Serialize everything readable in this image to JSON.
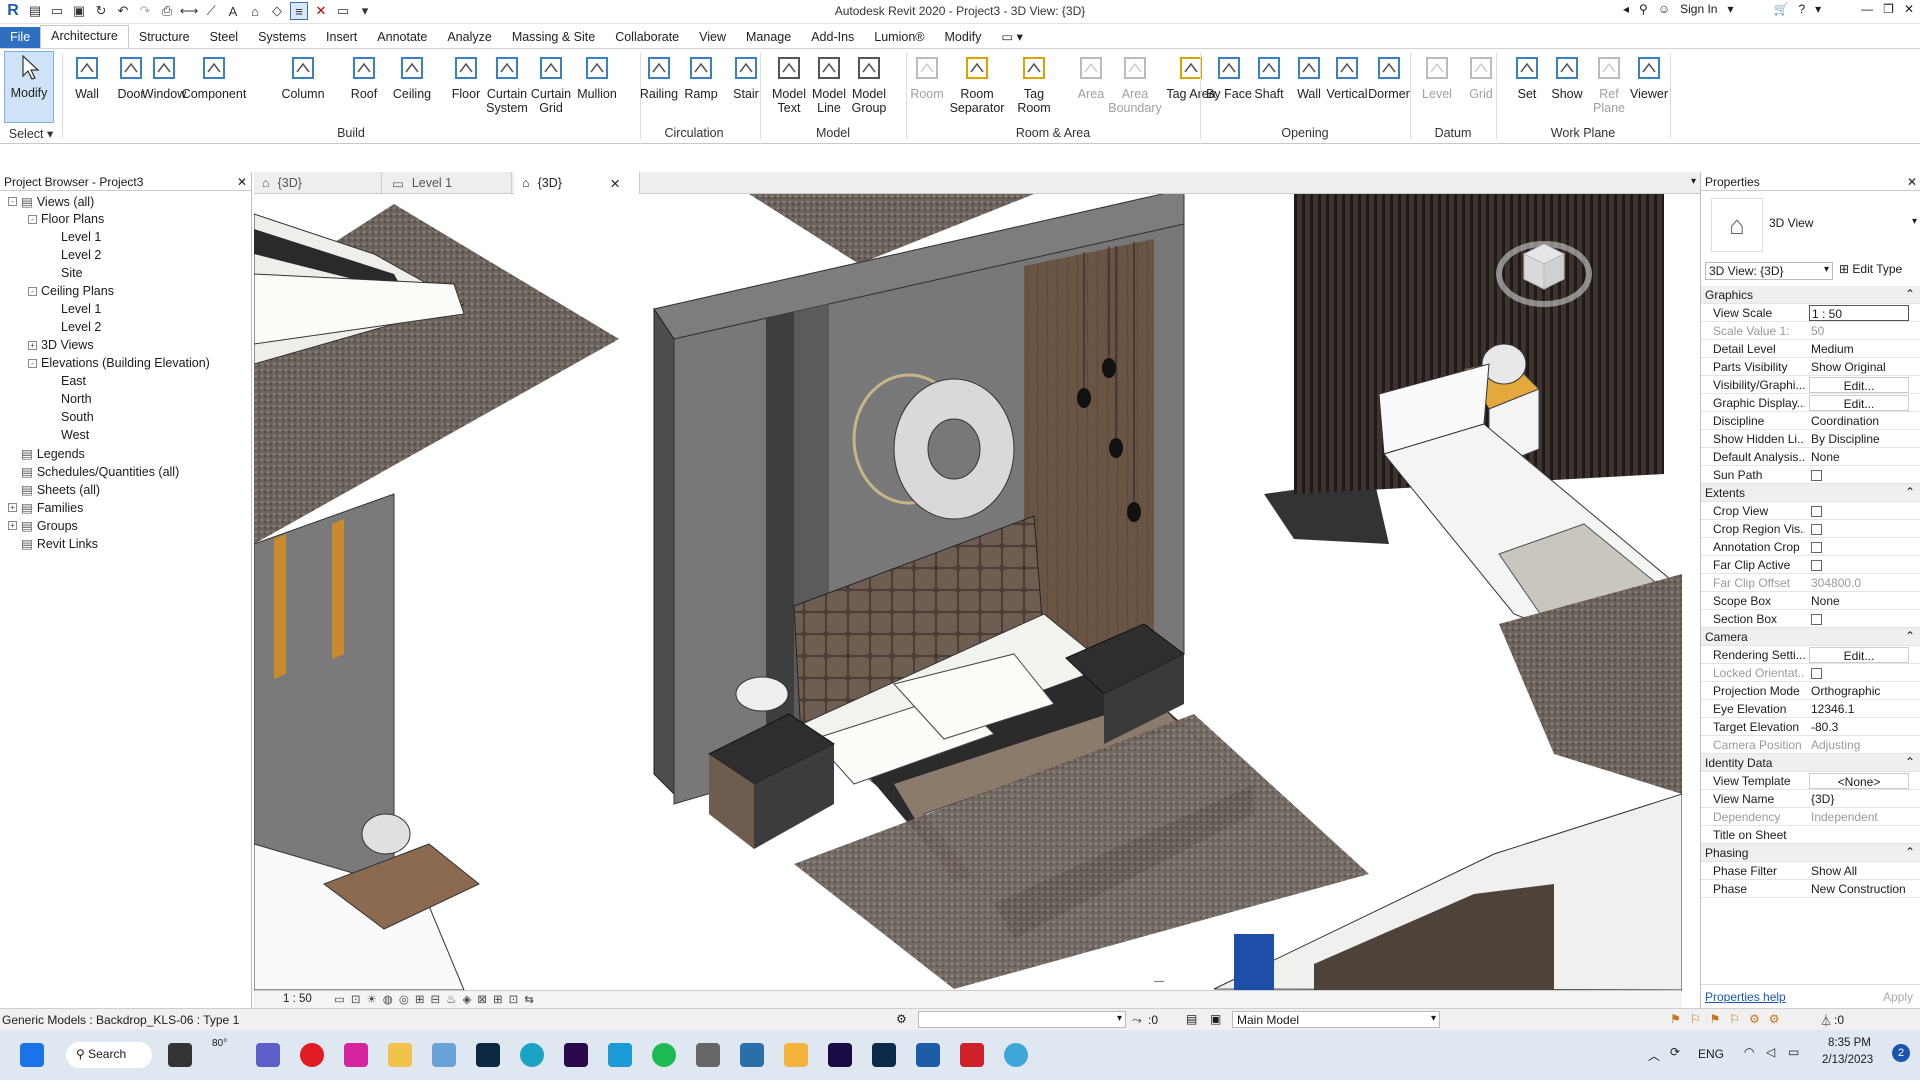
{
  "app_title": "Autodesk Revit 2020 - Project3 - 3D View: {3D}",
  "signin": "Sign In",
  "menu_tabs": [
    "File",
    "Architecture",
    "Structure",
    "Steel",
    "Systems",
    "Insert",
    "Annotate",
    "Analyze",
    "Massing & Site",
    "Collaborate",
    "View",
    "Manage",
    "Add-Ins",
    "Lumion®",
    "Modify"
  ],
  "ribbon": {
    "select_label": "Select",
    "modify": "Modify",
    "build": [
      "Wall",
      "Door",
      "Window",
      "Component",
      "Column",
      "Roof",
      "Ceiling",
      "Floor",
      "Curtain System",
      "Curtain Grid",
      "Mullion"
    ],
    "build_group": "Build",
    "circulation": [
      "Railing",
      "Ramp",
      "Stair"
    ],
    "circulation_group": "Circulation",
    "model": [
      "Model Text",
      "Model Line",
      "Model Group"
    ],
    "model_group": "Model",
    "room": [
      "Room",
      "Room Separator",
      "Tag Room",
      "Area",
      "Area Boundary",
      "Tag Area"
    ],
    "room_group": "Room & Area",
    "opening": [
      "By Face",
      "Shaft",
      "Wall",
      "Vertical",
      "Dormer"
    ],
    "opening_group": "Opening",
    "datum": [
      "Level",
      "Grid"
    ],
    "datum_group": "Datum",
    "workplane": [
      "Set",
      "Show",
      "Ref Plane",
      "Viewer"
    ],
    "workplane_group": "Work Plane"
  },
  "project_browser": {
    "title": "Project Browser - Project3",
    "items": [
      "Views (all)",
      "Floor Plans",
      "Level 1",
      "Level 2",
      "Site",
      "Ceiling Plans",
      "Level 1",
      "Level 2",
      "3D Views",
      "Elevations (Building Elevation)",
      "East",
      "North",
      "South",
      "West",
      "Legends",
      "Schedules/Quantities (all)",
      "Sheets (all)",
      "Families",
      "Groups",
      "Revit Links"
    ]
  },
  "view_tabs": [
    "{3D}",
    "Level 1",
    "{3D}"
  ],
  "view_scale_bar": "1 : 50",
  "properties": {
    "title": "Properties",
    "type": "3D View",
    "selector": "3D View: {3D}",
    "edit_type": "Edit Type",
    "rows": [
      {
        "s": "Graphics"
      },
      {
        "k": "View Scale",
        "v": "1 : 50"
      },
      {
        "k": "Scale Value    1:",
        "v": "50",
        "g": true
      },
      {
        "k": "Detail Level",
        "v": "Medium"
      },
      {
        "k": "Parts Visibility",
        "v": "Show Original"
      },
      {
        "k": "Visibility/Graphi...",
        "v": "Edit..."
      },
      {
        "k": "Graphic Display...",
        "v": "Edit..."
      },
      {
        "k": "Discipline",
        "v": "Coordination"
      },
      {
        "k": "Show Hidden Li...",
        "v": "By Discipline"
      },
      {
        "k": "Default Analysis...",
        "v": "None"
      },
      {
        "k": "Sun Path",
        "v": "",
        "cb": true
      },
      {
        "s": "Extents"
      },
      {
        "k": "Crop View",
        "v": "",
        "cb": true
      },
      {
        "k": "Crop Region Vis...",
        "v": "",
        "cb": true
      },
      {
        "k": "Annotation Crop",
        "v": "",
        "cb": true
      },
      {
        "k": "Far Clip Active",
        "v": "",
        "cb": true
      },
      {
        "k": "Far Clip Offset",
        "v": "304800.0",
        "g": true
      },
      {
        "k": "Scope Box",
        "v": "None"
      },
      {
        "k": "Section Box",
        "v": "",
        "cb": true
      },
      {
        "s": "Camera"
      },
      {
        "k": "Rendering Setti...",
        "v": "Edit..."
      },
      {
        "k": "Locked Orientat...",
        "v": "",
        "cb": true,
        "g": true
      },
      {
        "k": "Projection Mode",
        "v": "Orthographic"
      },
      {
        "k": "Eye Elevation",
        "v": "12346.1"
      },
      {
        "k": "Target Elevation",
        "v": "-80.3"
      },
      {
        "k": "Camera Position",
        "v": "Adjusting",
        "g": true
      },
      {
        "s": "Identity Data"
      },
      {
        "k": "View Template",
        "v": "<None>"
      },
      {
        "k": "View Name",
        "v": "{3D}"
      },
      {
        "k": "Dependency",
        "v": "Independent",
        "g": true
      },
      {
        "k": "Title on Sheet",
        "v": ""
      },
      {
        "s": "Phasing"
      },
      {
        "k": "Phase Filter",
        "v": "Show All"
      },
      {
        "k": "Phase",
        "v": "New Construction"
      }
    ],
    "help": "Properties help",
    "apply": "Apply"
  },
  "status": {
    "left": "Generic Models : Backdrop_KLS-06 : Type 1",
    "count": ":0",
    "model": "Main Model",
    "filter": ":0"
  },
  "taskbar": {
    "search": "Search",
    "lang": "ENG",
    "time": "8:35 PM",
    "date": "2/13/2023",
    "temp": "80°",
    "badge": "2"
  }
}
